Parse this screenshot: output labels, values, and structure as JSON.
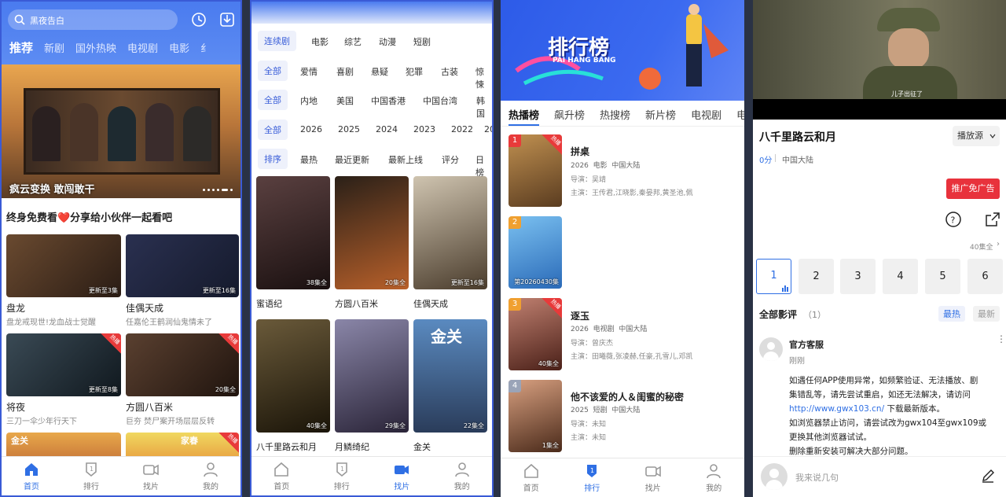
{
  "p1": {
    "search_placeholder": "黑夜告白",
    "nav": [
      "推荐",
      "新剧",
      "国外热映",
      "电视剧",
      "电影",
      "纟"
    ],
    "banner_title": "疯云变换 敢闯敢干",
    "share_title": "终身免费看❤️分享给小伙伴一起看吧",
    "cards": [
      {
        "title": "盘龙",
        "desc": "盘龙戒现世!龙血战士觉醒",
        "ep": "更新至3集",
        "hot": false,
        "color": "#4a3020"
      },
      {
        "title": "佳偶天成",
        "desc": "任嘉伦王鹤润仙鬼情未了",
        "ep": "更新至16集",
        "hot": false,
        "color": "#2c3350"
      },
      {
        "title": "将夜",
        "desc": "三刀一伞少年行天下",
        "ep": "更新至8集",
        "hot": true,
        "color": "#1e2b33"
      },
      {
        "title": "方圆八百米",
        "desc": "巨夯 焚尸案开场层层反转",
        "ep": "20集全",
        "hot": true,
        "color": "#3a2a22"
      }
    ],
    "partial_labels": [
      "金关",
      "家春"
    ],
    "hot_label": "热播",
    "tabs": [
      "首页",
      "排行",
      "找片",
      "我的"
    ]
  },
  "p2": {
    "rows": [
      [
        "连续剧",
        "电影",
        "综艺",
        "动漫",
        "短剧"
      ],
      [
        "全部",
        "爱情",
        "喜剧",
        "悬疑",
        "犯罪",
        "古装",
        "惊悚"
      ],
      [
        "全部",
        "内地",
        "美国",
        "中国香港",
        "中国台湾",
        "韩国"
      ],
      [
        "全部",
        "2026",
        "2025",
        "2024",
        "2023",
        "2022",
        "20"
      ],
      [
        "排序",
        "最热",
        "最近更新",
        "最新上线",
        "评分",
        "日榜"
      ]
    ],
    "posters": [
      {
        "title": "蜜语纪",
        "ep": "38集全",
        "color": "#2a1c1c"
      },
      {
        "title": "方圆八百米",
        "ep": "20集全",
        "color": "#5a3218"
      },
      {
        "title": "佳偶天成",
        "ep": "更新至16集",
        "color": "#4a4030"
      },
      {
        "title": "八千里路云和月",
        "ep": "40集全",
        "color": "#2a2418"
      },
      {
        "title": "月鳞绮纪",
        "ep": "29集全",
        "color": "#3a3450"
      },
      {
        "title": "金关",
        "ep": "22集全",
        "color": "#3c5a7c"
      }
    ],
    "poster_text": "金关",
    "tabs": [
      "首页",
      "排行",
      "找片",
      "我的"
    ]
  },
  "p3": {
    "banner_title": "排行榜",
    "banner_sub": "PAI HANG BANG",
    "tabs_top": [
      "热播榜",
      "飙升榜",
      "热搜榜",
      "新片榜",
      "电视剧",
      "电"
    ],
    "items": [
      {
        "rank": "1",
        "title": "拼桌",
        "meta": "2026  电影  中国大陆",
        "director": "导演：吴靖",
        "cast": "主演：王传君,江晓影,秦晏邦,黄圣池,佩",
        "ep": "",
        "color": "#8a6a3a"
      },
      {
        "rank": "2",
        "title": "",
        "meta": "",
        "director": "",
        "cast": "",
        "ep": "第20260430集",
        "color": "#3a8ad6"
      },
      {
        "rank": "3",
        "title": "逐玉",
        "meta": "2026  电视剧  中国大陆",
        "director": "导演：曾庆杰",
        "cast": "主演：田曦薇,张凌赫,任豪,孔雪儿,邓凯",
        "ep": "40集全",
        "color": "#7a3a30"
      },
      {
        "rank": "4",
        "title": "他不该爱的人＆闺蜜的秘密",
        "meta": "2025  短剧  中国大陆",
        "director": "导演：未知",
        "cast": "主演：未知",
        "ep": "1集全",
        "color": "#8a5a40"
      }
    ],
    "hot_label": "热播",
    "tabs": [
      "首页",
      "排行",
      "找片",
      "我的"
    ]
  },
  "p4": {
    "subtitle": "儿子出征了",
    "title": "八千里路云和月",
    "source": "播放源",
    "meta_score": "0分",
    "meta_region": "中国大陆",
    "promo": "推广免广告",
    "ep_count": "40集全",
    "episodes": [
      "1",
      "2",
      "3",
      "4",
      "5",
      "6"
    ],
    "comments_label": "全部影评",
    "comments_count": "（1）",
    "sort_hot": "最热",
    "sort_new": "最新",
    "comment": {
      "author": "官方客服",
      "time": "刚刚",
      "lines": [
        "如遇任何APP使用异常，如频繁验证、无法播放、剧",
        "集错乱等，请先尝试重启，如还无法解决，请访问"
      ],
      "url": "http://www.gwx103.cn/",
      "after_url": "下载最新版本。",
      "lines2": [
        "如浏览器禁止访问，请尝试改为gwx104至gwx109或",
        "更换其他浏览器试试。",
        "删除重新安装可解决大部分问题。"
      ]
    },
    "input_placeholder": "我来说几句"
  }
}
